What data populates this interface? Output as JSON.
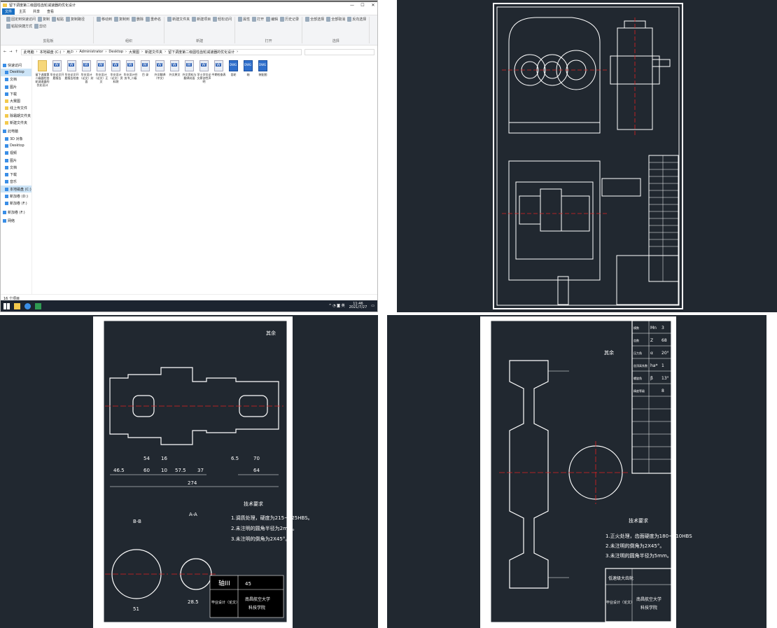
{
  "explorer": {
    "title": "留下调度第二级圆柱齿轮减速器的优化设计",
    "window_controls": {
      "minimize": "—",
      "maximize": "☐",
      "close": "✕"
    },
    "tabs": [
      "文件",
      "主页",
      "共享",
      "查看"
    ],
    "ribbon_groups": [
      {
        "label": "剪贴板",
        "items": [
          "固定到快速访问",
          "复制",
          "粘贴",
          "复制路径",
          "粘贴快捷方式",
          "剪切"
        ]
      },
      {
        "label": "组织",
        "items": [
          "移动到",
          "复制到",
          "删除",
          "重命名"
        ]
      },
      {
        "label": "新建",
        "items": [
          "新建文件夹",
          "新建项目",
          "轻松访问"
        ]
      },
      {
        "label": "打开",
        "items": [
          "属性",
          "打开",
          "编辑",
          "历史记录"
        ]
      },
      {
        "label": "选择",
        "items": [
          "全部选择",
          "全部取消",
          "反向选择"
        ]
      }
    ],
    "breadcrumb": [
      "此电脑",
      "本地磁盘 (C:)",
      "用户",
      "Administrator",
      "Desktop",
      "大赛图",
      "新建文件夹",
      "留下调度第二级圆柱齿轮减速器的优化设计"
    ],
    "sidebar": {
      "quick_access": "快速访问",
      "quick_items": [
        "Desktop",
        "文档",
        "图片",
        "下载",
        "大赛图",
        "线上传文件",
        "除霜期文件夹",
        "新建文件夹"
      ],
      "this_pc": "此电脑",
      "pc_items": [
        "3D 对象",
        "Desktop",
        "视频",
        "图片",
        "文档",
        "下载",
        "音乐",
        "本地磁盘 (C:)",
        "新加卷 (D:)",
        "新加卷 (F:)"
      ],
      "extra_drive": "新加卷 (F:)",
      "network": "网络"
    },
    "files": [
      {
        "name": "留下调度第二级圆柱齿轮减速器的优化设计",
        "type": "folder"
      },
      {
        "name": "毕业论文开题报告",
        "type": "word"
      },
      {
        "name": "毕业论文开题报告检查",
        "type": "word"
      },
      {
        "name": "毕业设计（论文）封面",
        "type": "word"
      },
      {
        "name": "毕业设计（论文）正文",
        "type": "word"
      },
      {
        "name": "毕业设计（论文）资料袋",
        "type": "word"
      },
      {
        "name": "毕业设计任务书_二级",
        "type": "word"
      },
      {
        "name": "目 录",
        "type": "word"
      },
      {
        "name": "外文翻译（中文）",
        "type": "word"
      },
      {
        "name": "外文原文",
        "type": "word"
      },
      {
        "name": "外文资料与翻译封面",
        "type": "word"
      },
      {
        "name": "学士学位论文原创性声明",
        "type": "word"
      },
      {
        "name": "中期检查表",
        "type": "word"
      },
      {
        "name": "齿轮",
        "type": "dwg"
      },
      {
        "name": "轴",
        "type": "dwg"
      },
      {
        "name": "装配图",
        "type": "dwg"
      }
    ],
    "status": "16 个项目",
    "taskbar": {
      "time": "11:46",
      "date": "2021/7/27"
    }
  },
  "shaft_drawing": {
    "roughness": "其余",
    "dims": [
      "46.5",
      "60",
      "10",
      "57.5",
      "37",
      "64",
      "54",
      "16",
      "6.5",
      "70",
      "274"
    ],
    "section_labels": [
      "B-B",
      "A-A"
    ],
    "section_dims": [
      "51",
      "28.5"
    ],
    "notes_title": "技术要求",
    "notes": [
      "1.调质处理，硬度为215~225HBS。",
      "2.未注明的圆角半径为2mm。",
      "3.未注明的倒角为2X45°。"
    ],
    "title_block": {
      "part": "轴III",
      "material": "45",
      "course": "毕业设计（论文）",
      "school": "南昌航空大学",
      "dept": "科技学院"
    }
  },
  "gear_drawing": {
    "roughness": "其余",
    "params": [
      [
        "模数",
        "Mn",
        "3"
      ],
      [
        "齿数",
        "Z",
        "68"
      ],
      [
        "压力角",
        "α",
        "20°"
      ],
      [
        "齿顶高系数",
        "ha*",
        "1"
      ],
      [
        "螺旋角",
        "β",
        "13°"
      ],
      [
        "精度等级",
        "",
        "8"
      ]
    ],
    "notes_title": "技术要求",
    "notes": [
      "1.正火处理，齿面硬度为180~210HBS",
      "2.未注明的倒角为2X45°。",
      "3.未注明的圆角半径为5mm。"
    ],
    "title_block": {
      "part": "低速级大齿轮",
      "course": "毕业设计（论文）",
      "school": "南昌航空大学",
      "dept": "科技学院"
    }
  },
  "assembly_drawing": {},
  "colors": {
    "cad_bg": "#212830",
    "cad_line": "#ffffff",
    "center_line": "#e02020",
    "accent": "#1a6fc2"
  }
}
